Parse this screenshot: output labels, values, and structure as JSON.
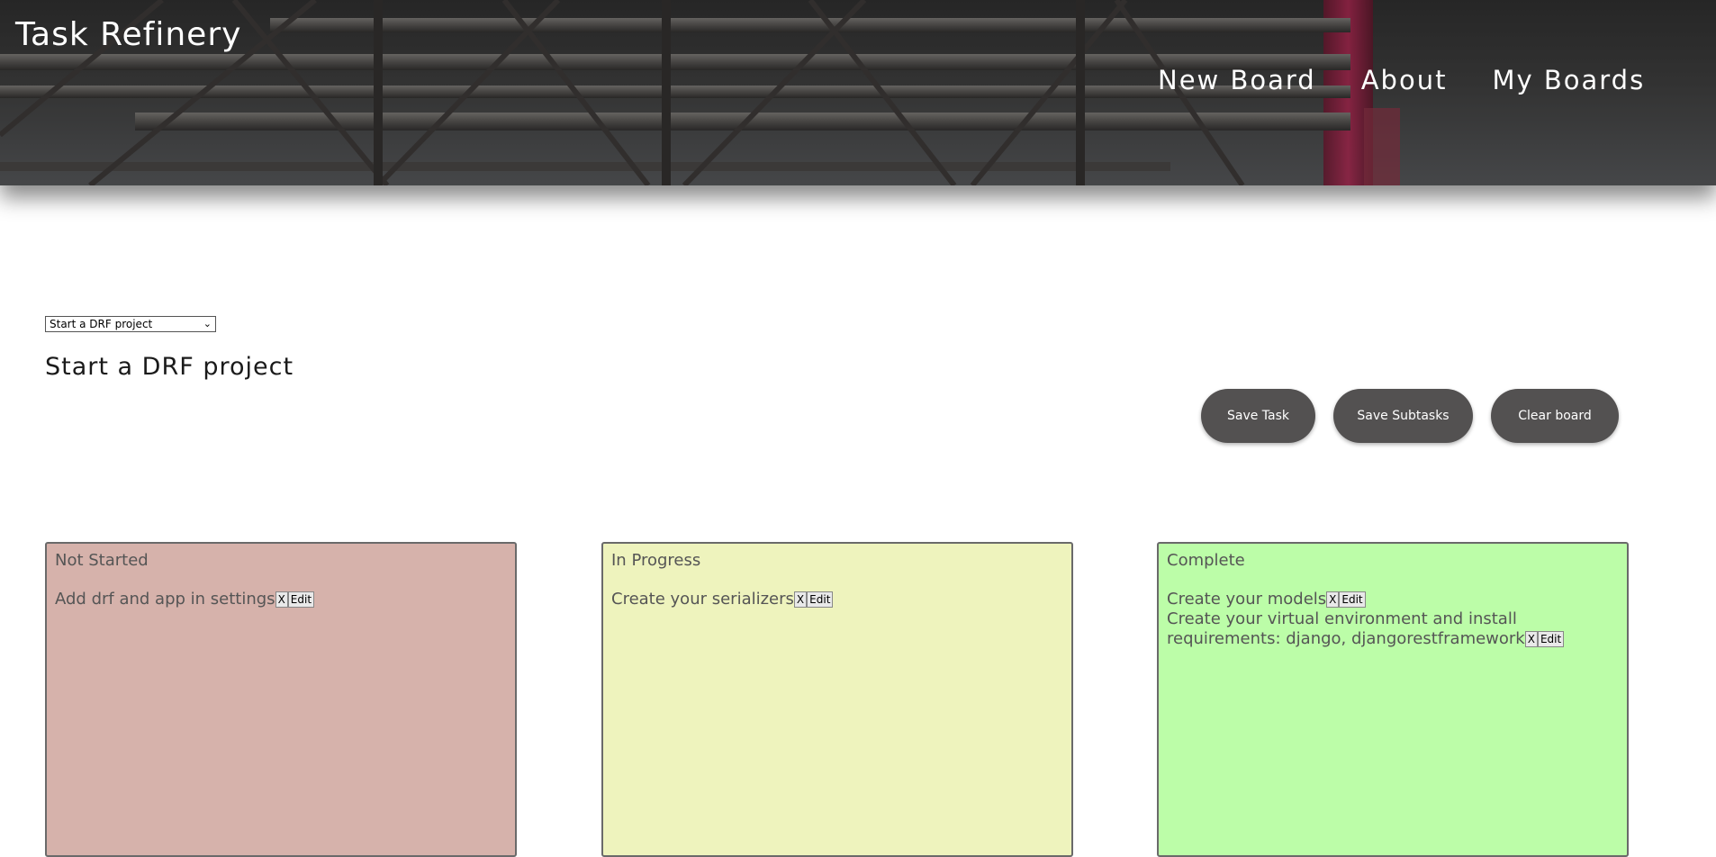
{
  "header": {
    "brand": "Task Refinery",
    "nav": [
      "New Board",
      "About",
      "My Boards"
    ]
  },
  "board": {
    "selected": "Start a DRF project",
    "title": "Start a DRF project"
  },
  "actions": {
    "save_task": "Save Task",
    "save_subtasks": "Save Subtasks",
    "clear_board": "Clear board"
  },
  "columns": [
    {
      "title": "Not Started",
      "color": "#d6b2ab",
      "tasks": [
        {
          "text": "Add drf and app in settings",
          "delete": "X",
          "edit": "Edit"
        }
      ]
    },
    {
      "title": "In Progress",
      "color": "#eef3bd",
      "tasks": [
        {
          "text": "Create your serializers",
          "delete": "X",
          "edit": "Edit"
        }
      ]
    },
    {
      "title": "Complete",
      "color": "#bcfda8",
      "tasks": [
        {
          "text": "Create your models",
          "delete": "X",
          "edit": "Edit"
        },
        {
          "text": "Create your virtual environment and install requirements: django, djangorestframework",
          "delete": "X",
          "edit": "Edit"
        }
      ]
    }
  ]
}
